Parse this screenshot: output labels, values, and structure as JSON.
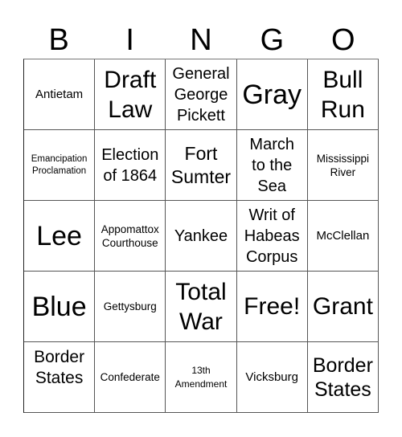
{
  "header": {
    "letters": [
      "B",
      "I",
      "N",
      "G",
      "O"
    ]
  },
  "cells": [
    [
      "Antietam",
      "Draft\nLaw",
      "General\nGeorge\nPickett",
      "Gray",
      "Bull\nRun"
    ],
    [
      "Emancipation\nProclamation",
      "Election\nof 1864",
      "Fort\nSumter",
      "March\nto the\nSea",
      "Mississippi\nRiver"
    ],
    [
      "Lee",
      "Appomattox\nCourthouse",
      "Yankee",
      "Writ of\nHabeas\nCorpus",
      "McClellan"
    ],
    [
      "Blue",
      "Gettysburg",
      "Total\nWar",
      "Free!",
      "Grant"
    ],
    [
      "Border\nStates",
      "Confederate",
      "13th\nAmendment",
      "Vicksburg",
      "Border\nStates"
    ]
  ]
}
